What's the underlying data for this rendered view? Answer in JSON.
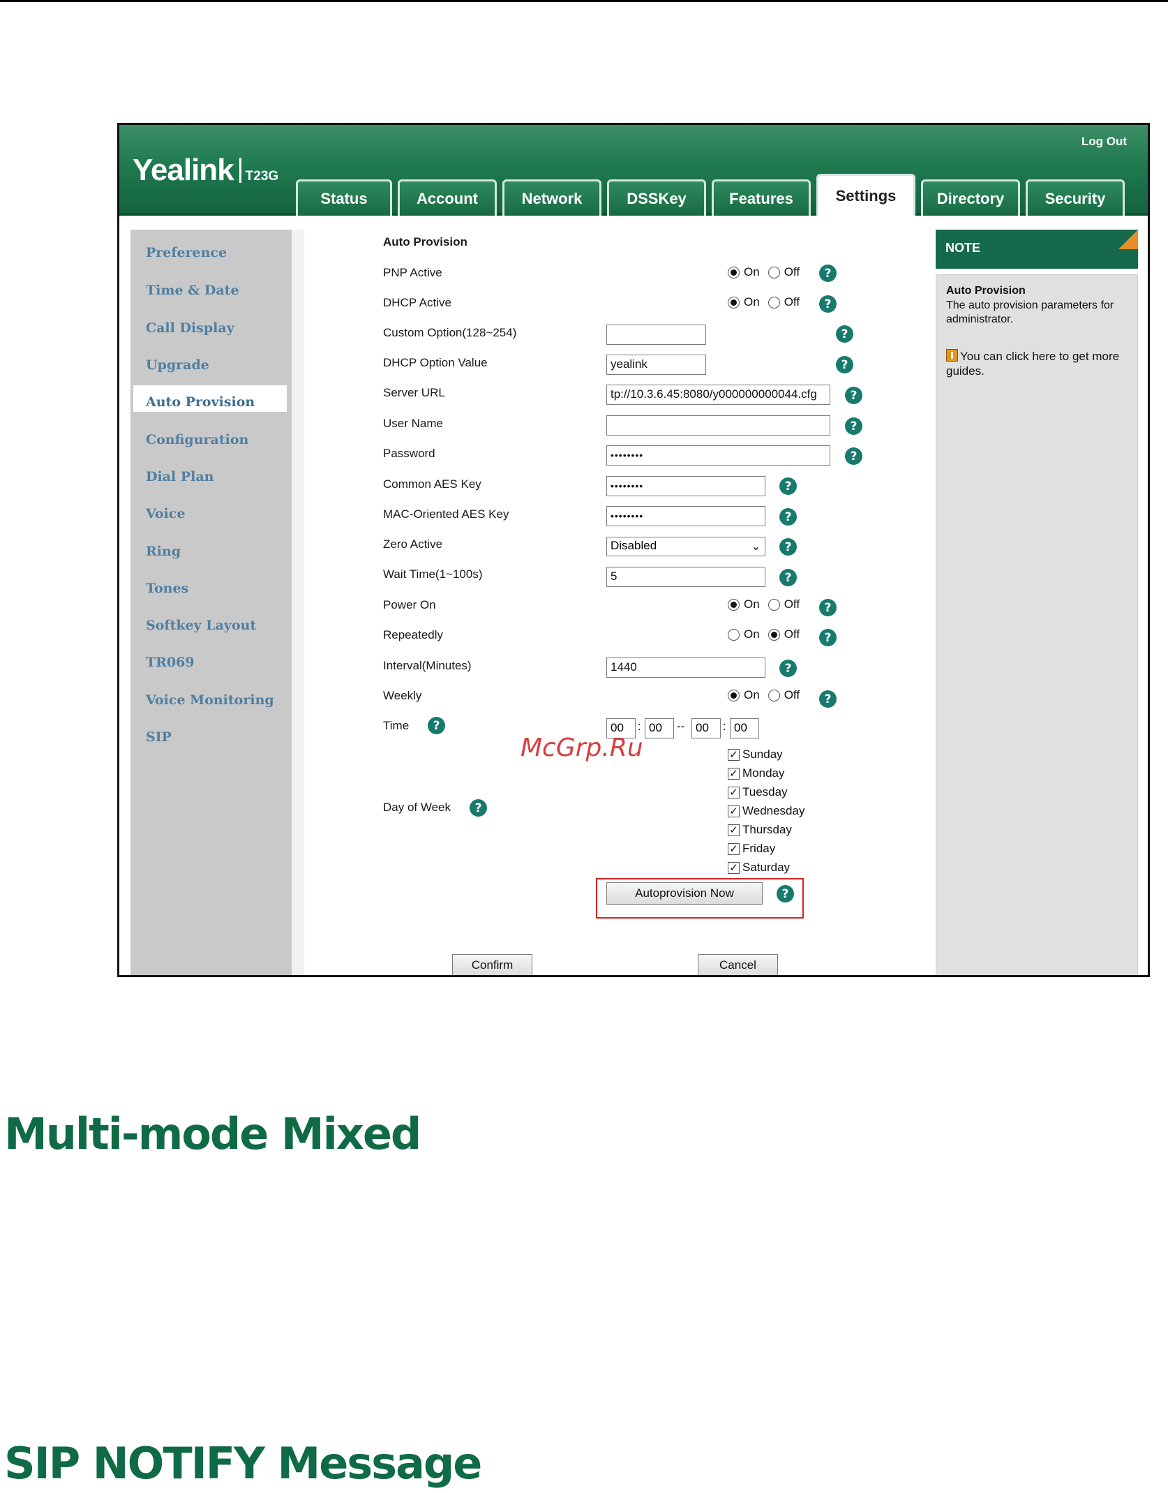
{
  "header": {
    "brand": "Yealink",
    "model": "T23G",
    "logout_label": "Log Out"
  },
  "tabs": [
    {
      "label": "Status",
      "active": false
    },
    {
      "label": "Account",
      "active": false
    },
    {
      "label": "Network",
      "active": false
    },
    {
      "label": "DSSKey",
      "active": false
    },
    {
      "label": "Features",
      "active": false
    },
    {
      "label": "Settings",
      "active": true
    },
    {
      "label": "Directory",
      "active": false
    },
    {
      "label": "Security",
      "active": false
    }
  ],
  "sidebar": {
    "items": [
      {
        "label": "Preference"
      },
      {
        "label": "Time & Date"
      },
      {
        "label": "Call Display"
      },
      {
        "label": "Upgrade"
      },
      {
        "label": "Auto Provision",
        "active": true
      },
      {
        "label": "Configuration"
      },
      {
        "label": "Dial Plan"
      },
      {
        "label": "Voice"
      },
      {
        "label": "Ring"
      },
      {
        "label": "Tones"
      },
      {
        "label": "Softkey Layout"
      },
      {
        "label": "TR069"
      },
      {
        "label": "Voice Monitoring"
      },
      {
        "label": "SIP"
      }
    ]
  },
  "form": {
    "section_title": "Auto Provision",
    "pnp_active": {
      "label": "PNP Active",
      "on_label": "On",
      "off_label": "Off",
      "value": "On"
    },
    "dhcp_active": {
      "label": "DHCP Active",
      "on_label": "On",
      "off_label": "Off",
      "value": "On"
    },
    "custom_option": {
      "label": "Custom Option(128~254)",
      "value": ""
    },
    "dhcp_option_value": {
      "label": "DHCP Option Value",
      "value": "yealink"
    },
    "server_url": {
      "label": "Server URL",
      "value": "tp://10.3.6.45:8080/y000000000044.cfg"
    },
    "user_name": {
      "label": "User Name",
      "value": ""
    },
    "password": {
      "label": "Password",
      "value": "••••••••"
    },
    "common_aes_key": {
      "label": "Common AES Key",
      "value": "••••••••"
    },
    "mac_aes_key": {
      "label": "MAC-Oriented AES Key",
      "value": "••••••••"
    },
    "zero_active": {
      "label": "Zero Active",
      "value": "Disabled"
    },
    "wait_time": {
      "label": "Wait Time(1~100s)",
      "value": "5"
    },
    "power_on": {
      "label": "Power On",
      "on_label": "On",
      "off_label": "Off",
      "value": "On"
    },
    "repeatedly": {
      "label": "Repeatedly",
      "on_label": "On",
      "off_label": "Off",
      "value": "Off"
    },
    "interval": {
      "label": "Interval(Minutes)",
      "value": "1440"
    },
    "weekly": {
      "label": "Weekly",
      "on_label": "On",
      "off_label": "Off",
      "value": "On"
    },
    "time": {
      "label": "Time",
      "start_hour": "00",
      "start_min": "00",
      "end_hour": "00",
      "end_min": "00",
      "colon": ":",
      "dash": "--"
    },
    "day_of_week": {
      "label": "Day of Week",
      "days": [
        {
          "label": "Sunday",
          "checked": true
        },
        {
          "label": "Monday",
          "checked": true
        },
        {
          "label": "Tuesday",
          "checked": true
        },
        {
          "label": "Wednesday",
          "checked": true
        },
        {
          "label": "Thursday",
          "checked": true
        },
        {
          "label": "Friday",
          "checked": true
        },
        {
          "label": "Saturday",
          "checked": true
        }
      ]
    },
    "autoprovision_now_label": "Autoprovision Now",
    "confirm_label": "Confirm",
    "cancel_label": "Cancel",
    "help_glyph": "?",
    "check_glyph": "✓"
  },
  "note": {
    "header": "NOTE",
    "title": "Auto Provision",
    "text": "The auto provision parameters for administrator.",
    "link_text": "You can click here to get more guides."
  },
  "watermark": "McGrp.Ru",
  "headings": {
    "h1": "Multi-mode Mixed",
    "h2": "SIP NOTIFY Message"
  },
  "icons": [
    "help-icon",
    "book-icon",
    "chevron-down-icon"
  ],
  "colors": {
    "brand_green": "#1f7a50",
    "help_teal": "#177a6d",
    "heading_green": "#0f6b45",
    "sidebar_link": "#4f7fa1",
    "highlight_red": "#e02020",
    "note_corner": "#e88d26"
  }
}
